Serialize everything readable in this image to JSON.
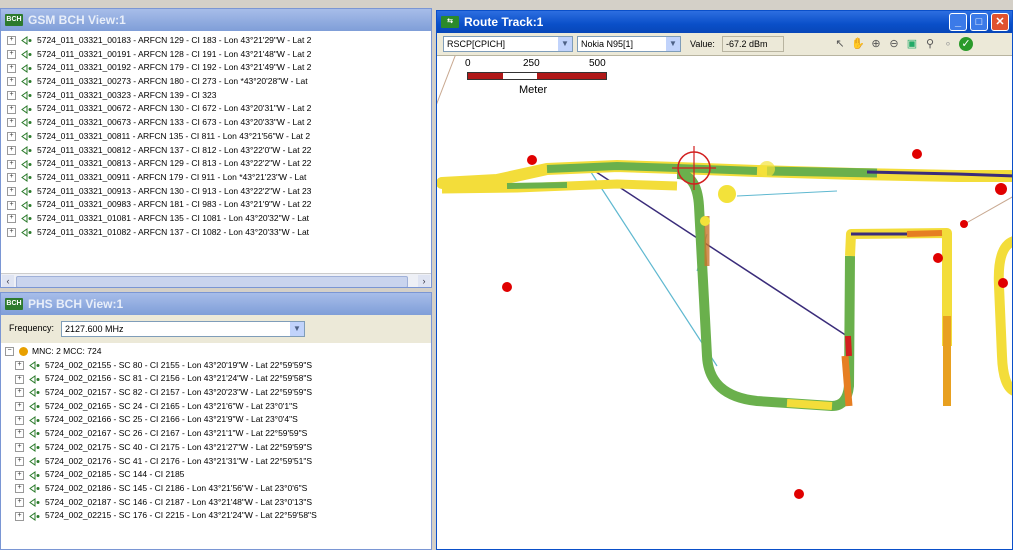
{
  "gsm_panel": {
    "title": "GSM BCH View:1",
    "items": [
      "5724_011_03321_00183 - ARFCN 129 - CI 183 - Lon 43°21'29\"W - Lat 2",
      "5724_011_03321_00191 - ARFCN 128 - CI 191 - Lon 43°21'48\"W - Lat 2",
      "5724_011_03321_00192 - ARFCN 179 - CI 192 - Lon 43°21'49\"W - Lat 2",
      "5724_011_03321_00273 - ARFCN 180 - CI 273 - Lon *43°20'28\"W - Lat",
      "5724_011_03321_00323 - ARFCN 139 - CI 323",
      "5724_011_03321_00672 - ARFCN 130 - CI 672 - Lon 43°20'31\"W - Lat 2",
      "5724_011_03321_00673 - ARFCN 133 - CI 673 - Lon 43°20'33\"W - Lat 2",
      "5724_011_03321_00811 - ARFCN 135 - CI 811 - Lon 43°21'56\"W - Lat 2",
      "5724_011_03321_00812 - ARFCN 137 - CI 812 - Lon 43°22'0\"W - Lat 22",
      "5724_011_03321_00813 - ARFCN 129 - CI 813 - Lon 43°22'2\"W - Lat 22",
      "5724_011_03321_00911 - ARFCN 179 - CI 911 - Lon *43°21'23\"W - Lat",
      "5724_011_03321_00913 - ARFCN 130 - CI 913 - Lon 43°22'2\"W - Lat 23",
      "5724_011_03321_00983 - ARFCN 181 - CI 983 - Lon 43°21'9\"W - Lat 22",
      "5724_011_03321_01081 - ARFCN 135 - CI 1081 - Lon 43°20'32\"W - Lat",
      "5724_011_03321_01082 - ARFCN 137 - CI 1082 - Lon 43°20'33\"W - Lat"
    ]
  },
  "phs_panel": {
    "title": "PHS BCH View:1",
    "frequency_label": "Frequency:",
    "frequency_value": "2127.600 MHz",
    "root": "MNC: 2  MCC: 724",
    "items": [
      "5724_002_02155 - SC 80 - CI 2155 - Lon 43°20'19\"W - Lat 22°59'59\"S",
      "5724_002_02156 - SC 81 - CI 2156 - Lon 43°21'24\"W - Lat 22°59'58\"S",
      "5724_002_02157 - SC 82 - CI 2157 - Lon 43°20'23\"W - Lat 22°59'59\"S",
      "5724_002_02165 - SC 24 - CI 2165 - Lon 43°21'6\"W - Lat 23°0'1\"S",
      "5724_002_02166 - SC 25 - CI 2166 - Lon 43°21'9\"W - Lat 23°0'4\"S",
      "5724_002_02167 - SC 26 - CI 2167 - Lon 43°21'1\"W - Lat 22°59'59\"S",
      "5724_002_02175 - SC 40 - CI 2175 - Lon 43°21'27\"W - Lat 22°59'59\"S",
      "5724_002_02176 - SC 41 - CI 2176 - Lon 43°21'31\"W - Lat 22°59'51\"S",
      "5724_002_02185 - SC 144 - CI 2185",
      "5724_002_02186 - SC 145 - CI 2186 - Lon 43°21'56\"W - Lat 23°0'6\"S",
      "5724_002_02187 - SC 146 - CI 2187 - Lon 43°21'48\"W - Lat 23°0'13\"S",
      "5724_002_02215 - SC 176 - CI 2215 - Lon 43°21'24\"W - Lat 22°59'58\"S"
    ]
  },
  "route_panel": {
    "title": "Route Track:1",
    "metric_select": "RSCP[CPICH]",
    "device_select": "Nokia N95[1]",
    "value_label": "Value:",
    "value": "-67.2 dBm",
    "scale_ticks": [
      "0",
      "250",
      "500"
    ],
    "scale_unit": "Meter"
  },
  "colors": {
    "title_active": "#0a4fc9",
    "title_inactive": "#8aa6dc",
    "route_good": "#6ab04c",
    "route_fair": "#f4e04d",
    "route_poor": "#e67e22",
    "site_marker": "#e00000"
  }
}
